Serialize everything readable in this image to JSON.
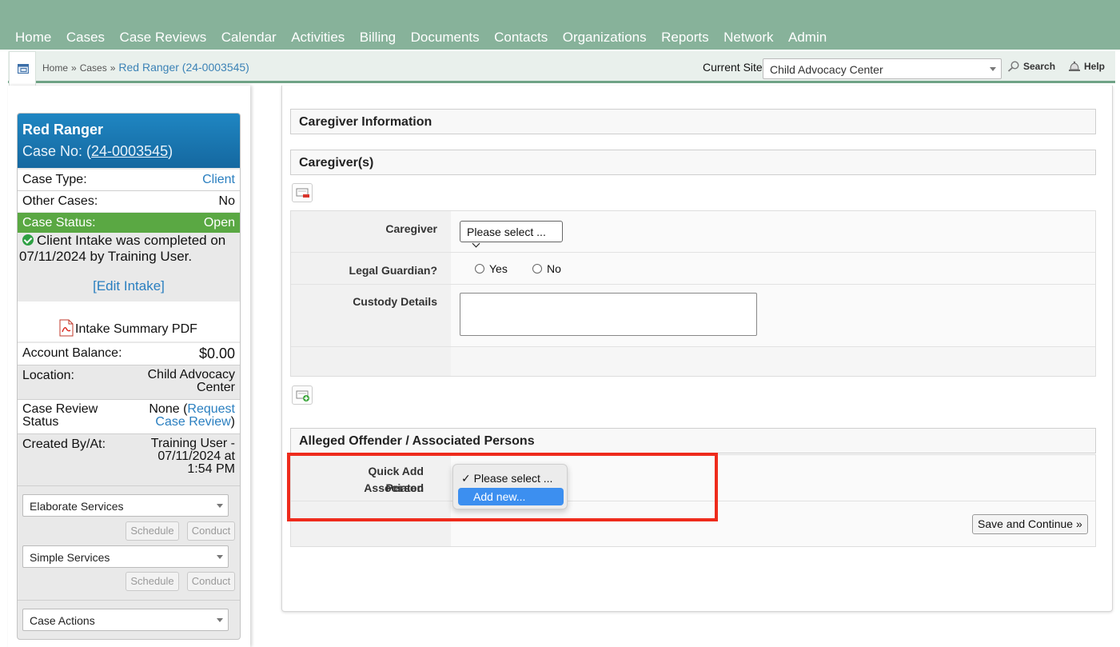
{
  "nav": {
    "items": [
      "Home",
      "Cases",
      "Case Reviews",
      "Calendar",
      "Activities",
      "Billing",
      "Documents",
      "Contacts",
      "Organizations",
      "Reports",
      "Network",
      "Admin"
    ]
  },
  "breadcrumb": {
    "home": "Home",
    "sep": "»",
    "cases": "Cases",
    "current": "Red Ranger (24-0003545)"
  },
  "header": {
    "site_label": "Current Site",
    "site_value": "Child Advocacy Center",
    "search_label": "Search",
    "help_label": "Help"
  },
  "case": {
    "name": "Red Ranger",
    "case_no_prefix": "Case No: (",
    "case_no": "24-0003545",
    "case_no_suffix": ")",
    "case_type_label": "Case Type:",
    "case_type_value": "Client",
    "other_cases_label": "Other Cases:",
    "other_cases_value": "No",
    "status_label": "Case Status:",
    "status_value": "Open",
    "intake_note": "Client Intake was completed on 07/11/2024 by Training User.",
    "edit_intake": "[Edit Intake]",
    "pdf_label": "Intake Summary PDF",
    "balance_label": "Account Balance:",
    "balance_value": "$0.00",
    "location_label": "Location:",
    "location_value_1": "Child Advocacy",
    "location_value_2": "Center",
    "review_label_1": "Case Review",
    "review_label_2": "Status",
    "review_value_1a": "None (",
    "review_value_1b": "Request",
    "review_value_2a": "Case Review",
    "review_value_2b": ")",
    "created_label": "Created By/At:",
    "created_value_1": "Training User -",
    "created_value_2": "07/11/2024 at",
    "created_value_3": "1:54 PM",
    "elaborate_services": "Elaborate Services",
    "simple_services": "Simple Services",
    "schedule": "Schedule",
    "conduct": "Conduct",
    "case_actions": "Case Actions"
  },
  "main": {
    "caregiver_info_header": "Caregiver Information",
    "caregivers_header": "Caregiver(s)",
    "caregiver_label": "Caregiver",
    "caregiver_select": "Please select ...",
    "legal_guardian_label": "Legal Guardian?",
    "yes": "Yes",
    "no": "No",
    "custody_label": "Custody Details",
    "offender_header": "Alleged Offender / Associated Persons",
    "quick_add_label_1": "Quick Add Associated",
    "quick_add_label_2": "Person",
    "dropdown_options": [
      "✓ Please select ...",
      "Add new..."
    ],
    "save_continue": "Save and Continue »"
  },
  "colors": {
    "nav_bg": "#87b29a",
    "case_head": "#1f86c2",
    "status_green": "#5aa843",
    "link_blue": "#2a7fc0",
    "highlight_red": "#ee2b1c",
    "dropdown_selected": "#3c8ff0"
  }
}
